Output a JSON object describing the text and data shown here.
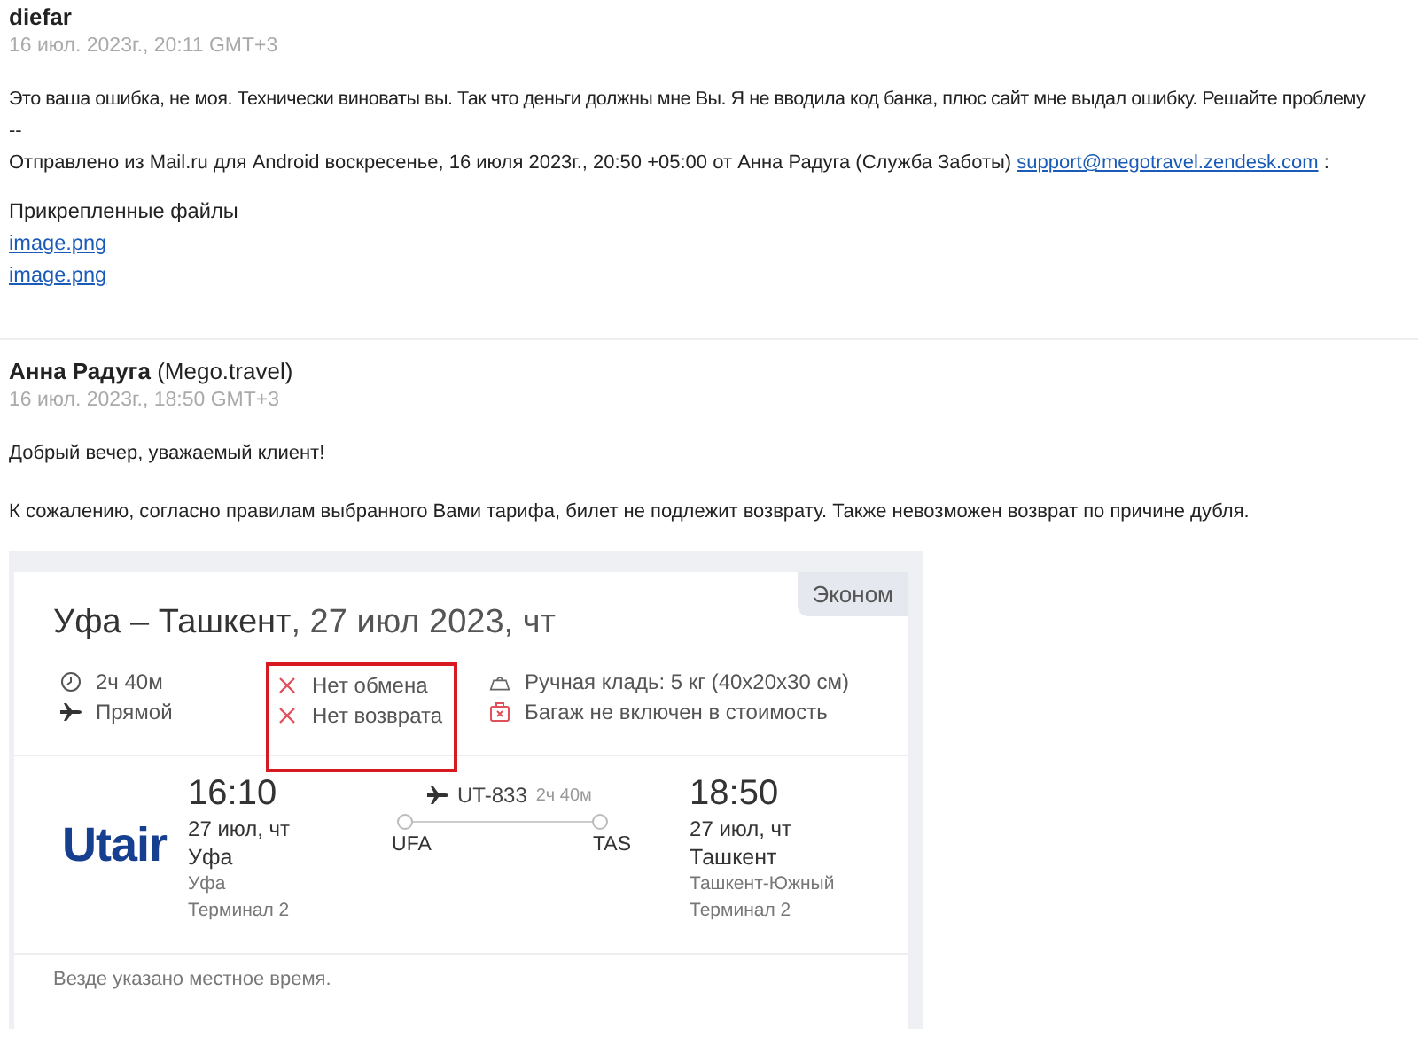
{
  "message_1": {
    "author": "diefar",
    "date": "16 июл. 2023г., 20:11 GMT+3",
    "body": "Это ваша ошибка, не моя. Технически виноваты вы. Так что деньги должны мне Вы. Я не вводила код банка, плюс сайт мне выдал ошибку. Решайте проблему",
    "separator": "--",
    "quote_text": "Отправлено из Mail.ru для Android воскресенье, 16 июля 2023г., 20:50 +05:00 от Анна Радуга (Служба Заботы) ",
    "quote_link": "support@megotravel.zendesk.com",
    "quote_tail": " :",
    "attachments_title": "Прикрепленные файлы",
    "attachments": [
      "image.png",
      "image.png"
    ]
  },
  "message_2": {
    "author": "Анна Радуга",
    "org": "(Mego.travel)",
    "date": "16 июл. 2023г., 18:50 GMT+3",
    "paragraphs": [
      "Добрый вечер, уважаемый клиент!",
      "К сожалению, согласно правилам выбранного Вами тарифа, билет не подлежит возврату. Также невозможен возврат по причине дубля."
    ]
  },
  "ticket": {
    "class": "Эконом",
    "route": "Уфа – Ташкент",
    "date": ", 27 июл 2023, чт",
    "features": [
      {
        "highlighted": false,
        "items": [
          {
            "kind": "clock",
            "text": "2ч 40м"
          },
          {
            "kind": "plane",
            "text": "Прямой"
          }
        ]
      },
      {
        "highlighted": true,
        "items": [
          {
            "kind": "cross",
            "text": "Нет обмена"
          },
          {
            "kind": "cross",
            "text": "Нет возврата"
          }
        ]
      },
      {
        "highlighted": false,
        "items": [
          {
            "kind": "handbag",
            "text": "Ручная кладь: 5 кг (40x20x30 см)"
          },
          {
            "kind": "luggage",
            "text": "Багаж не включен в стоимость"
          }
        ]
      }
    ],
    "airline": "Utair",
    "departure": {
      "time": "16:10",
      "date": "27 июл, чт",
      "city": "Уфа",
      "airport": "Уфа",
      "terminal": "Терминал 2"
    },
    "flight": {
      "number": "UT-833",
      "duration": "2ч 40м",
      "from": "UFA",
      "to": "TAS"
    },
    "arrival": {
      "time": "18:50",
      "date": "27 июл, чт",
      "city": "Ташкент",
      "airport": "Ташкент-Южный",
      "terminal": "Терминал 2"
    },
    "note": "Везде указано местное время."
  }
}
